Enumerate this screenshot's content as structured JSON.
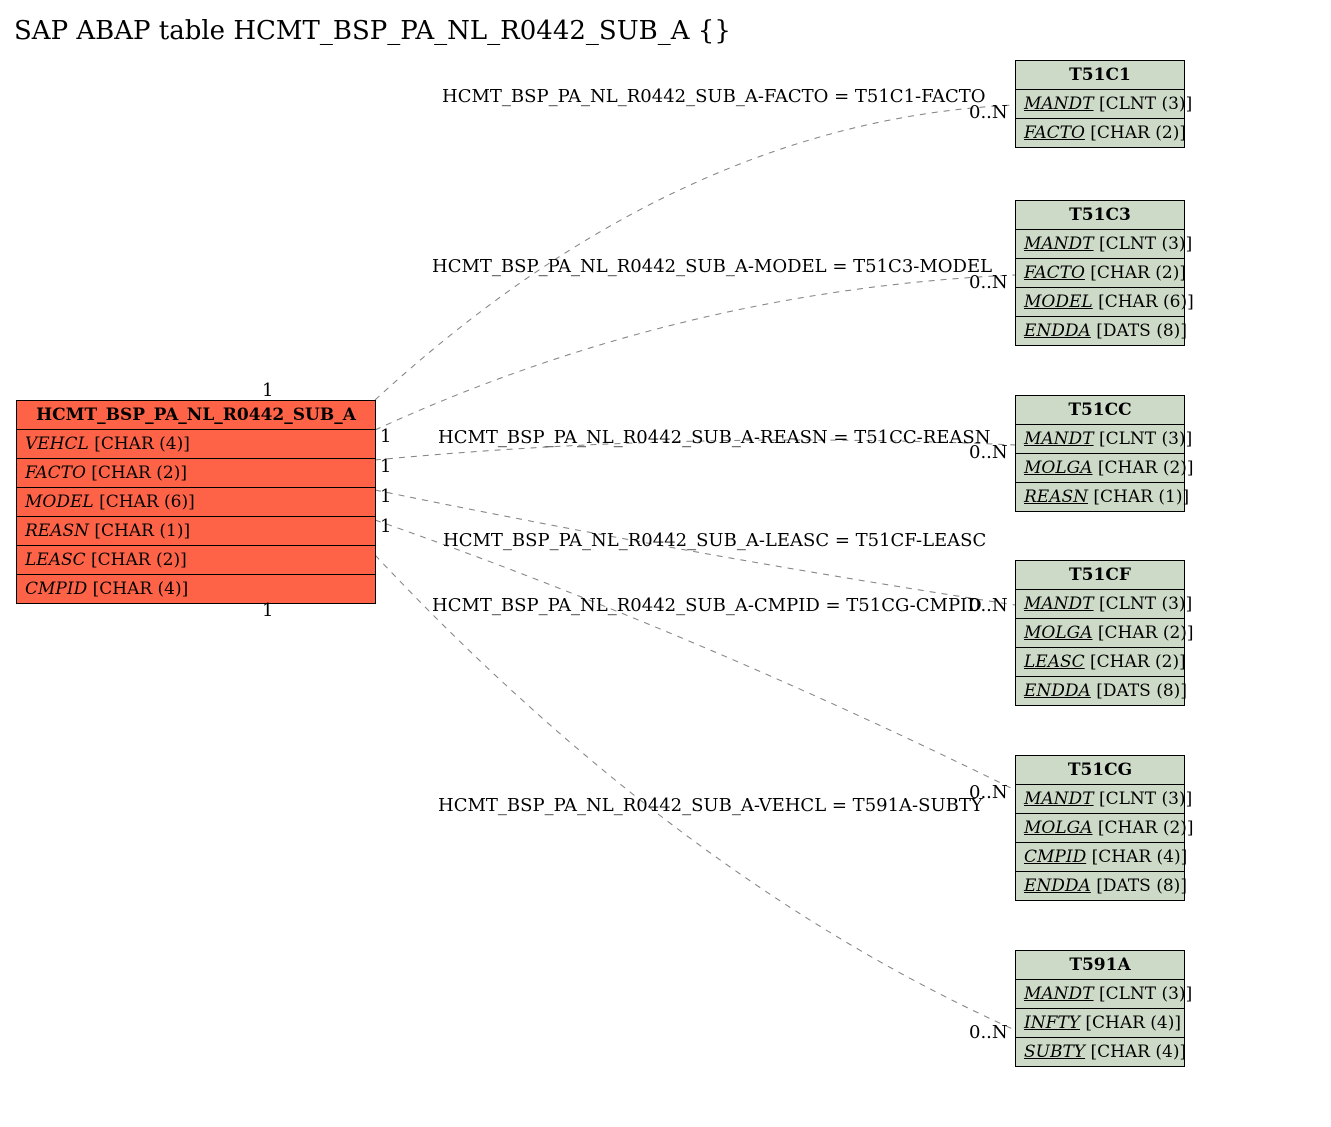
{
  "title": "SAP ABAP table HCMT_BSP_PA_NL_R0442_SUB_A {}",
  "mainEntity": {
    "name": "HCMT_BSP_PA_NL_R0442_SUB_A",
    "fields": [
      {
        "name": "VEHCL",
        "type": "[CHAR (4)]"
      },
      {
        "name": "FACTO",
        "type": "[CHAR (2)]"
      },
      {
        "name": "MODEL",
        "type": "[CHAR (6)]"
      },
      {
        "name": "REASN",
        "type": "[CHAR (1)]"
      },
      {
        "name": "LEASC",
        "type": "[CHAR (2)]"
      },
      {
        "name": "CMPID",
        "type": "[CHAR (4)]"
      }
    ]
  },
  "relEntities": [
    {
      "name": "T51C1",
      "fields": [
        {
          "name": "MANDT",
          "type": "[CLNT (3)]",
          "key": true
        },
        {
          "name": "FACTO",
          "type": "[CHAR (2)]",
          "key": true
        }
      ]
    },
    {
      "name": "T51C3",
      "fields": [
        {
          "name": "MANDT",
          "type": "[CLNT (3)]",
          "key": true
        },
        {
          "name": "FACTO",
          "type": "[CHAR (2)]",
          "key": true
        },
        {
          "name": "MODEL",
          "type": "[CHAR (6)]",
          "key": true
        },
        {
          "name": "ENDDA",
          "type": "[DATS (8)]",
          "key": true
        }
      ]
    },
    {
      "name": "T51CC",
      "fields": [
        {
          "name": "MANDT",
          "type": "[CLNT (3)]",
          "key": true
        },
        {
          "name": "MOLGA",
          "type": "[CHAR (2)]",
          "key": true
        },
        {
          "name": "REASN",
          "type": "[CHAR (1)]",
          "key": true
        }
      ]
    },
    {
      "name": "T51CF",
      "fields": [
        {
          "name": "MANDT",
          "type": "[CLNT (3)]",
          "key": true
        },
        {
          "name": "MOLGA",
          "type": "[CHAR (2)]",
          "key": true
        },
        {
          "name": "LEASC",
          "type": "[CHAR (2)]",
          "key": true
        },
        {
          "name": "ENDDA",
          "type": "[DATS (8)]",
          "key": true
        }
      ]
    },
    {
      "name": "T51CG",
      "fields": [
        {
          "name": "MANDT",
          "type": "[CLNT (3)]",
          "key": true
        },
        {
          "name": "MOLGA",
          "type": "[CHAR (2)]",
          "key": true
        },
        {
          "name": "CMPID",
          "type": "[CHAR (4)]",
          "key": true
        },
        {
          "name": "ENDDA",
          "type": "[DATS (8)]",
          "key": true
        }
      ]
    },
    {
      "name": "T591A",
      "fields": [
        {
          "name": "MANDT",
          "type": "[CLNT (3)]",
          "key": true
        },
        {
          "name": "INFTY",
          "type": "[CHAR (4)]",
          "key": true
        },
        {
          "name": "SUBTY",
          "type": "[CHAR (4)]",
          "key": true
        }
      ]
    }
  ],
  "relations": [
    {
      "label": "HCMT_BSP_PA_NL_R0442_SUB_A-FACTO = T51C1-FACTO",
      "leftCard": "1",
      "rightCard": "0..N"
    },
    {
      "label": "HCMT_BSP_PA_NL_R0442_SUB_A-MODEL = T51C3-MODEL",
      "leftCard": "1",
      "rightCard": "0..N"
    },
    {
      "label": "HCMT_BSP_PA_NL_R0442_SUB_A-REASN = T51CC-REASN",
      "leftCard": "1",
      "rightCard": "0..N"
    },
    {
      "label": "HCMT_BSP_PA_NL_R0442_SUB_A-LEASC = T51CF-LEASC",
      "leftCard": "1",
      "rightCard": "0..N"
    },
    {
      "label": "HCMT_BSP_PA_NL_R0442_SUB_A-CMPID = T51CG-CMPID",
      "leftCard": "1",
      "rightCard": "0..N"
    },
    {
      "label": "HCMT_BSP_PA_NL_R0442_SUB_A-VEHCL = T591A-SUBTY",
      "leftCard": "1",
      "rightCard": "0..N"
    }
  ],
  "chart_data": {
    "type": "table",
    "title": "SAP ABAP table HCMT_BSP_PA_NL_R0442_SUB_A ER diagram",
    "main_table": "HCMT_BSP_PA_NL_R0442_SUB_A",
    "main_fields": [
      "VEHCL CHAR(4)",
      "FACTO CHAR(2)",
      "MODEL CHAR(6)",
      "REASN CHAR(1)",
      "LEASC CHAR(2)",
      "CMPID CHAR(4)"
    ],
    "related_tables": [
      "T51C1",
      "T51C3",
      "T51CC",
      "T51CF",
      "T51CG",
      "T591A"
    ],
    "relationships": [
      {
        "from": "HCMT_BSP_PA_NL_R0442_SUB_A.FACTO",
        "to": "T51C1.FACTO",
        "cardinality": "1 to 0..N"
      },
      {
        "from": "HCMT_BSP_PA_NL_R0442_SUB_A.MODEL",
        "to": "T51C3.MODEL",
        "cardinality": "1 to 0..N"
      },
      {
        "from": "HCMT_BSP_PA_NL_R0442_SUB_A.REASN",
        "to": "T51CC.REASN",
        "cardinality": "1 to 0..N"
      },
      {
        "from": "HCMT_BSP_PA_NL_R0442_SUB_A.LEASC",
        "to": "T51CF.LEASC",
        "cardinality": "1 to 0..N"
      },
      {
        "from": "HCMT_BSP_PA_NL_R0442_SUB_A.CMPID",
        "to": "T51CG.CMPID",
        "cardinality": "1 to 0..N"
      },
      {
        "from": "HCMT_BSP_PA_NL_R0442_SUB_A.VEHCL",
        "to": "T591A.SUBTY",
        "cardinality": "1 to 0..N"
      }
    ]
  }
}
